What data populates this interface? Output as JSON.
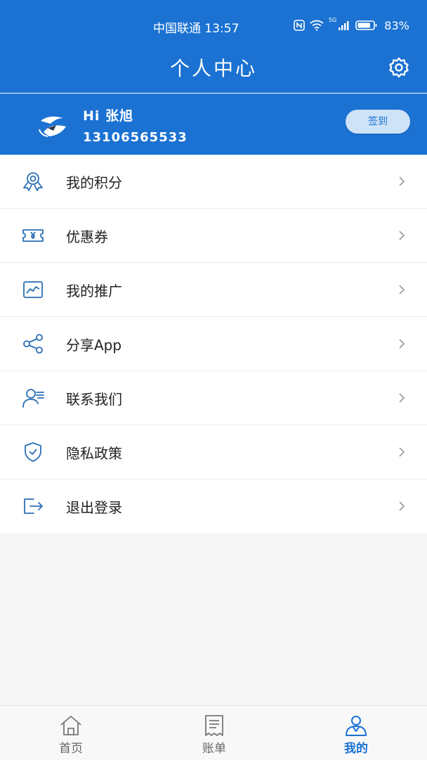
{
  "status_bar": {
    "carrier_time": "中国联通 13:57",
    "network_label": "5G",
    "battery_percent": "83%"
  },
  "header": {
    "title": "个人中心",
    "settings_icon": "gear-icon"
  },
  "profile": {
    "greeting": "Hi 张旭",
    "phone": "13106565533",
    "signin_label": "签到",
    "avatar_icon": "app-logo"
  },
  "menu": [
    {
      "label": "我的积分",
      "icon": "medal-icon"
    },
    {
      "label": "优惠券",
      "icon": "coupon-icon"
    },
    {
      "label": "我的推广",
      "icon": "trend-chart-icon"
    },
    {
      "label": "分享App",
      "icon": "share-icon"
    },
    {
      "label": "联系我们",
      "icon": "contact-icon"
    },
    {
      "label": "隐私政策",
      "icon": "shield-icon"
    },
    {
      "label": "退出登录",
      "icon": "logout-icon"
    }
  ],
  "tabs": [
    {
      "label": "首页",
      "icon": "home-icon",
      "active": false
    },
    {
      "label": "账单",
      "icon": "bill-icon",
      "active": false
    },
    {
      "label": "我的",
      "icon": "user-icon",
      "active": true
    }
  ],
  "colors": {
    "primary": "#1b72d2",
    "icon_stroke": "#2b6fb5"
  }
}
